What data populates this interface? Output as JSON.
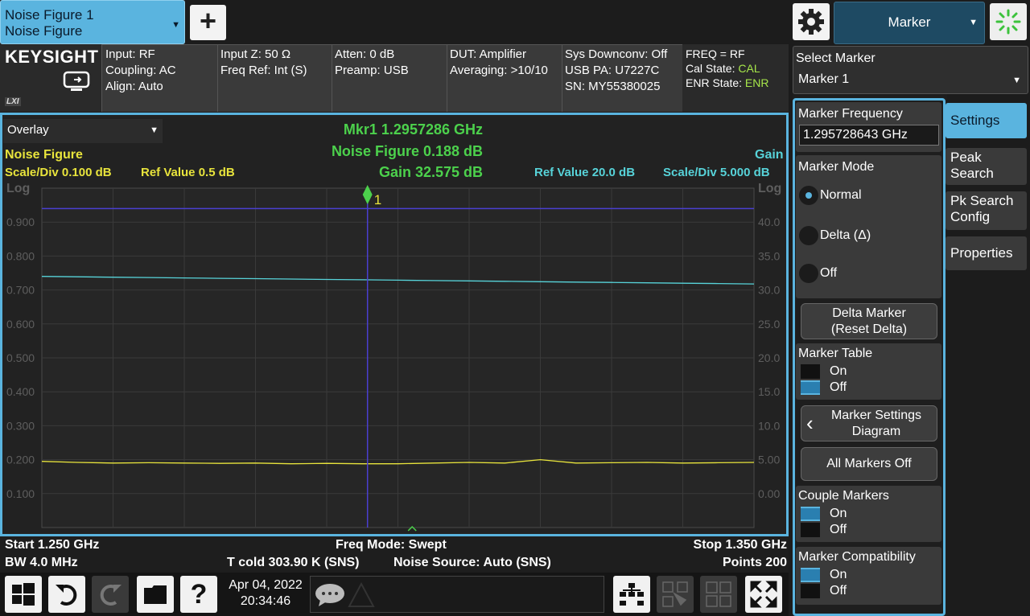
{
  "measurement_tab": {
    "line1": "Noise Figure 1",
    "line2": "Noise Figure"
  },
  "menu": {
    "selected": "Marker"
  },
  "brand": "KEYSIGHT",
  "lxi_label": "LXI",
  "info": {
    "col1": [
      "Input: RF",
      "Coupling: AC",
      "Align: Auto"
    ],
    "col2": [
      "Input Z: 50 Ω",
      "Freq Ref: Int (S)"
    ],
    "col3": [
      "Atten: 0 dB",
      "Preamp: USB"
    ],
    "col4": [
      "DUT: Amplifier",
      "Averaging: >10/10"
    ],
    "col5": [
      "Sys Downconv: Off",
      "USB PA: U7227C",
      "SN: MY55380025"
    ],
    "col6_freq": "FREQ = RF",
    "cal_label": "Cal State: ",
    "cal_value": "CAL",
    "enr_label": "ENR State: ",
    "enr_value": "ENR"
  },
  "view": {
    "selected": "Overlay"
  },
  "trace_left": {
    "name": "Noise Figure",
    "scale": "Scale/Div 0.100 dB",
    "ref": "Ref Value 0.5 dB",
    "scale_type": "Log"
  },
  "trace_right": {
    "name": "Gain",
    "scale": "Scale/Div 5.000 dB",
    "ref": "Ref Value 20.0 dB",
    "scale_type": "Log"
  },
  "marker_readout": {
    "line1": "Mkr1  1.2957286 GHz",
    "line2": "Noise Figure 0.188 dB",
    "line3": "Gain 32.575 dB",
    "marker_label": "1"
  },
  "axis_left": [
    "0.900",
    "0.800",
    "0.700",
    "0.600",
    "0.500",
    "0.400",
    "0.300",
    "0.200",
    "0.100"
  ],
  "axis_right": [
    "40.0",
    "35.0",
    "30.0",
    "25.0",
    "20.0",
    "15.0",
    "10.0",
    "5.00",
    "0.00"
  ],
  "chart_data": {
    "type": "line",
    "x_start_ghz": 1.25,
    "x_stop_ghz": 1.35,
    "series": [
      {
        "name": "Noise Figure",
        "axis": "left",
        "ylim": [
          0.0,
          1.0
        ],
        "values": [
          0.195,
          0.192,
          0.19,
          0.191,
          0.19,
          0.189,
          0.19,
          0.188,
          0.189,
          0.188,
          0.188,
          0.19,
          0.192,
          0.19,
          0.2,
          0.19,
          0.191,
          0.192,
          0.19,
          0.191,
          0.192
        ]
      },
      {
        "name": "Gain",
        "axis": "right",
        "ylim": [
          0.0,
          45.0
        ],
        "values": [
          33.3,
          33.25,
          33.2,
          33.15,
          33.1,
          33.05,
          33.0,
          32.95,
          32.9,
          32.85,
          32.8,
          32.75,
          32.7,
          32.65,
          32.6,
          32.55,
          32.5,
          32.45,
          32.4,
          32.35,
          32.3
        ]
      }
    ],
    "marker": {
      "x_ghz": 1.2957286,
      "level_left": 0.94
    }
  },
  "colors": {
    "nf": "#e8e43c",
    "gain": "#57d3d9",
    "marker": "#4a3fd1",
    "grid": "#3a3a3a"
  },
  "status": {
    "start": "Start 1.250 GHz",
    "bw": "BW 4.0 MHz",
    "freq_mode": "Freq Mode: Swept",
    "tcold": "T cold 303.90 K (SNS)",
    "noise_source": "Noise Source: Auto (SNS)",
    "stop": "Stop 1.350 GHz",
    "points": "Points 200"
  },
  "datetime": {
    "date": "Apr 04, 2022",
    "time": "20:34:46"
  },
  "panel": {
    "select_marker_label": "Select Marker",
    "select_marker_value": "Marker 1",
    "marker_freq_label": "Marker Frequency",
    "marker_freq_value": "1.295728643 GHz",
    "marker_mode_label": "Marker Mode",
    "mode_normal": "Normal",
    "mode_delta": "Delta (Δ)",
    "mode_off": "Off",
    "delta_marker_l1": "Delta Marker",
    "delta_marker_l2": "(Reset Delta)",
    "marker_table_label": "Marker Table",
    "on": "On",
    "off": "Off",
    "msd_l1": "Marker Settings",
    "msd_l2": "Diagram",
    "all_markers_off": "All Markers Off",
    "couple_markers_label": "Couple Markers",
    "marker_compat_label": "Marker Compatibility"
  },
  "tabs": {
    "settings": "Settings",
    "peak_l1": "Peak",
    "peak_l2": "Search",
    "pks_l1": "Pk Search",
    "pks_l2": "Config",
    "properties": "Properties"
  }
}
